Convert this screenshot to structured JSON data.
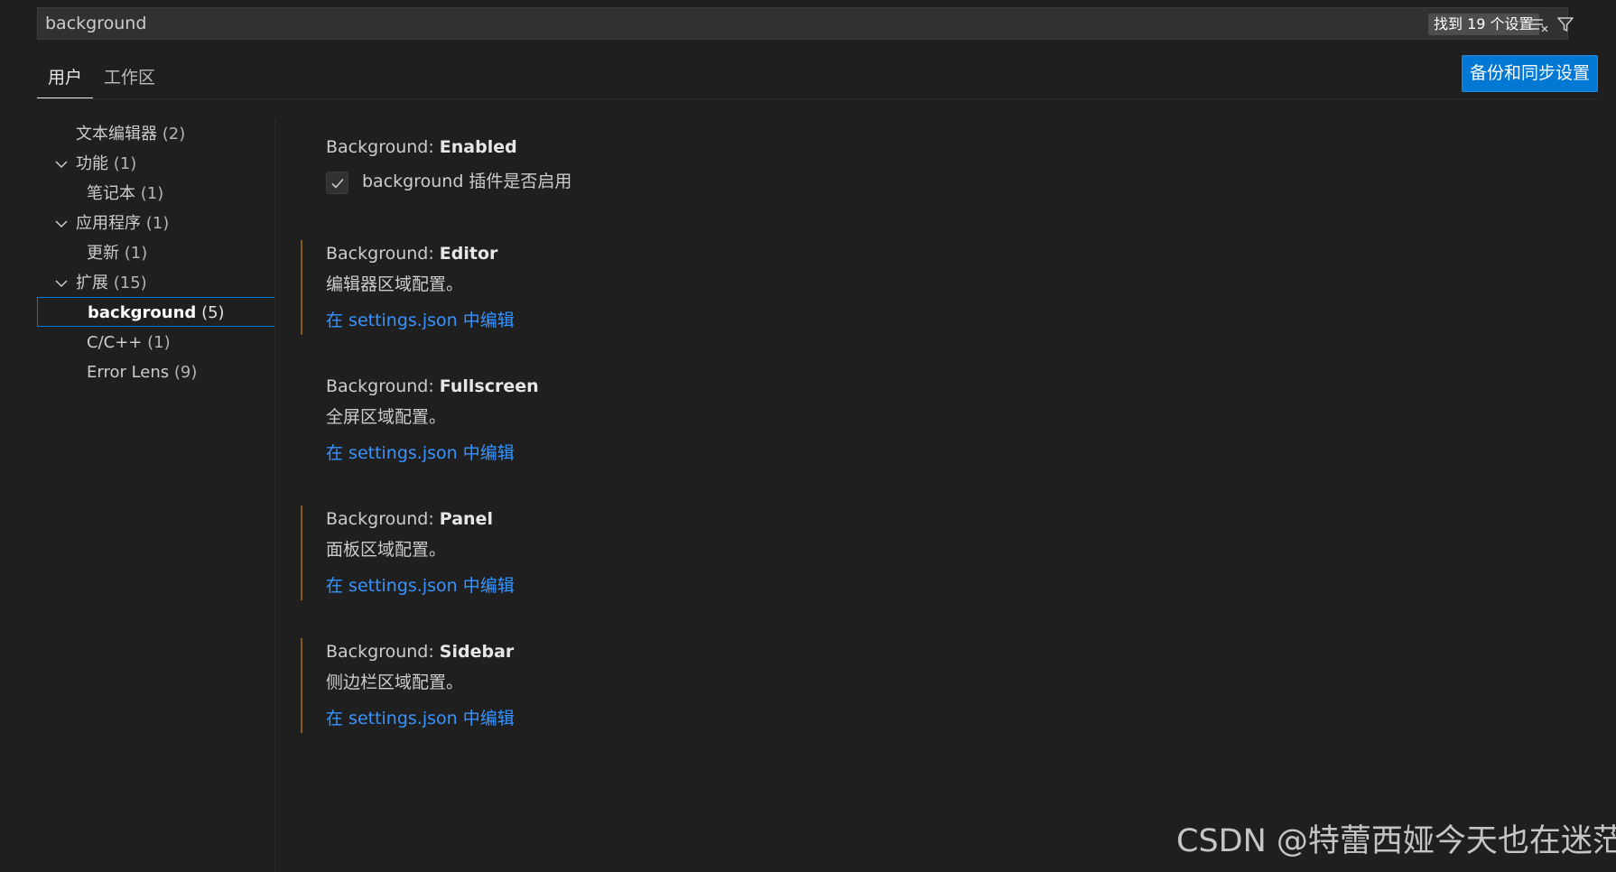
{
  "search": {
    "value": "background",
    "result_count": "找到 19 个设置",
    "clear_icon": "clear-filter-icon",
    "filter_icon": "filter-icon"
  },
  "tabs": [
    {
      "label": "用户",
      "active": true
    },
    {
      "label": "工作区",
      "active": false
    }
  ],
  "sync_button": "备份和同步设置",
  "toc": [
    {
      "label": "文本编辑器",
      "count": "(2)",
      "level": 0,
      "expandable": false
    },
    {
      "label": "功能",
      "count": "(1)",
      "level": 0,
      "expandable": true
    },
    {
      "label": "笔记本",
      "count": "(1)",
      "level": 1,
      "expandable": false
    },
    {
      "label": "应用程序",
      "count": "(1)",
      "level": 0,
      "expandable": true
    },
    {
      "label": "更新",
      "count": "(1)",
      "level": 1,
      "expandable": false
    },
    {
      "label": "扩展",
      "count": "(15)",
      "level": 0,
      "expandable": true
    },
    {
      "label": "background",
      "count": "(5)",
      "level": 1,
      "expandable": false,
      "selected": true
    },
    {
      "label": "C/C++",
      "count": "(1)",
      "level": 1,
      "expandable": false
    },
    {
      "label": "Error Lens",
      "count": "(9)",
      "level": 1,
      "expandable": false
    }
  ],
  "settings": [
    {
      "category": "Background: ",
      "key": "Enabled",
      "type": "checkbox",
      "checked": true,
      "checkbox_label": "background 插件是否启用"
    },
    {
      "category": "Background: ",
      "key": "Editor",
      "description": "编辑器区域配置。",
      "link": "在 settings.json 中编辑"
    },
    {
      "category": "Background: ",
      "key": "Fullscreen",
      "description": "全屏区域配置。",
      "link": "在 settings.json 中编辑"
    },
    {
      "category": "Background: ",
      "key": "Panel",
      "description": "面板区域配置。",
      "link": "在 settings.json 中编辑"
    },
    {
      "category": "Background: ",
      "key": "Sidebar",
      "description": "侧边栏区域配置。",
      "link": "在 settings.json 中编辑"
    }
  ],
  "watermark": "CSDN @特蕾西娅今天也在迷茫",
  "colors": {
    "background": "#1f1f1f",
    "accent": "#0078d4",
    "link": "#3794ff",
    "modified_bar": "#8b5a17"
  }
}
